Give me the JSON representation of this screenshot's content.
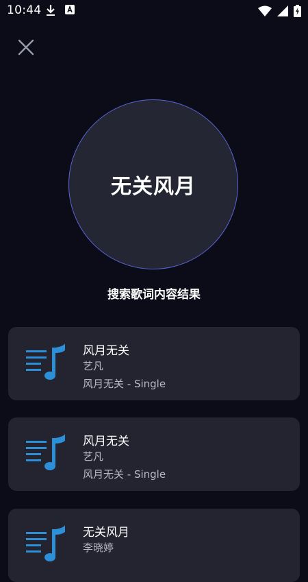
{
  "status_bar": {
    "time": "10:44",
    "icons": [
      "download-icon",
      "a-notification-icon",
      "wifi-icon",
      "cell-signal-icon",
      "battery-charging-icon"
    ]
  },
  "header": {
    "close_icon": "close-icon"
  },
  "query": {
    "title": "无关风月"
  },
  "results_label": "搜索歌词内容结果",
  "results": [
    {
      "title": "风月无关",
      "artist": "艺凡",
      "album": "风月无关 - Single"
    },
    {
      "title": "风月无关",
      "artist": "艺凡",
      "album": "风月无关 - Single"
    },
    {
      "title": "无关风月",
      "artist": "李晓婷",
      "album": ""
    }
  ],
  "colors": {
    "background": "#0b0c18",
    "card": "#232430",
    "circle_fill": "#242633",
    "circle_border": "#5b64d6",
    "icon_blue": "#2d8fd8"
  }
}
